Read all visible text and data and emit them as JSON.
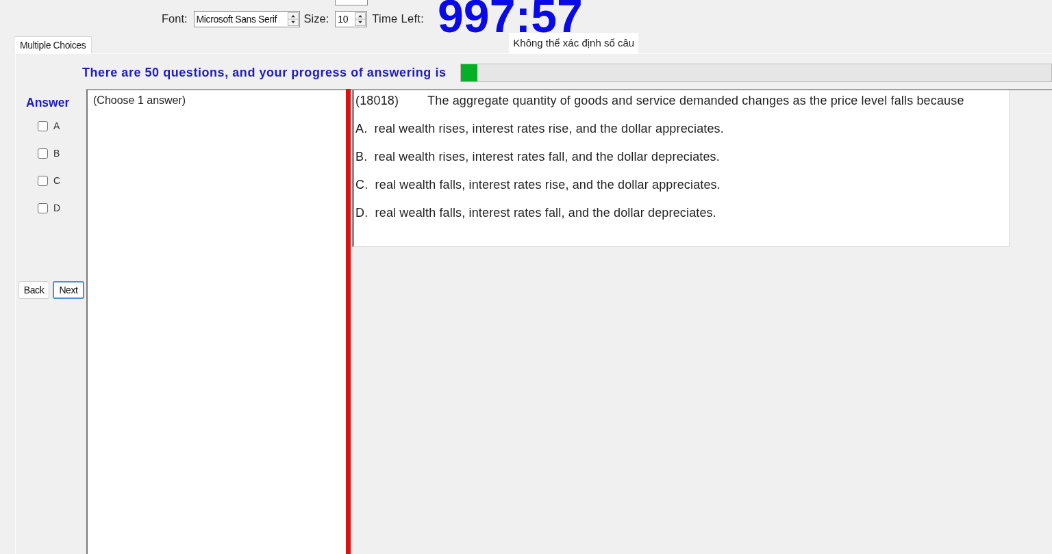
{
  "toolbar": {
    "font_label": "Font:",
    "font_value": "Microsoft Sans Serif",
    "size_label": "Size:",
    "size_value": "10",
    "time_label": "Time Left:",
    "timer": "997:57"
  },
  "status_label": "Không thể xác định số câu",
  "tabs": [
    {
      "label": "Multiple Choices",
      "selected": true
    }
  ],
  "progress": {
    "text": "There are 50 questions, and your progress of answering is",
    "level": 0.028
  },
  "answer_panel": {
    "title": "Answer",
    "options": [
      {
        "label": "A",
        "checked": false
      },
      {
        "label": "B",
        "checked": false
      },
      {
        "label": "C",
        "checked": false
      },
      {
        "label": "D",
        "checked": false
      }
    ],
    "buttons": [
      {
        "label": "Back",
        "focused": false
      },
      {
        "label": "Next",
        "focused": true
      }
    ]
  },
  "selection_box": {
    "text": "(Choose 1 answer)"
  },
  "question": {
    "number": "(18018)",
    "text": "The aggregate quantity of goods and service demanded changes as the price level falls because",
    "choices": [
      "A.  real wealth rises, interest rates rise, and the dollar appreciates.",
      "B.  real wealth rises, interest rates fall, and the dollar depreciates.",
      "C.  real wealth falls, interest rates rise, and the dollar appreciates.",
      "D.  real wealth falls, interest rates fall, and the dollar depreciates."
    ]
  }
}
